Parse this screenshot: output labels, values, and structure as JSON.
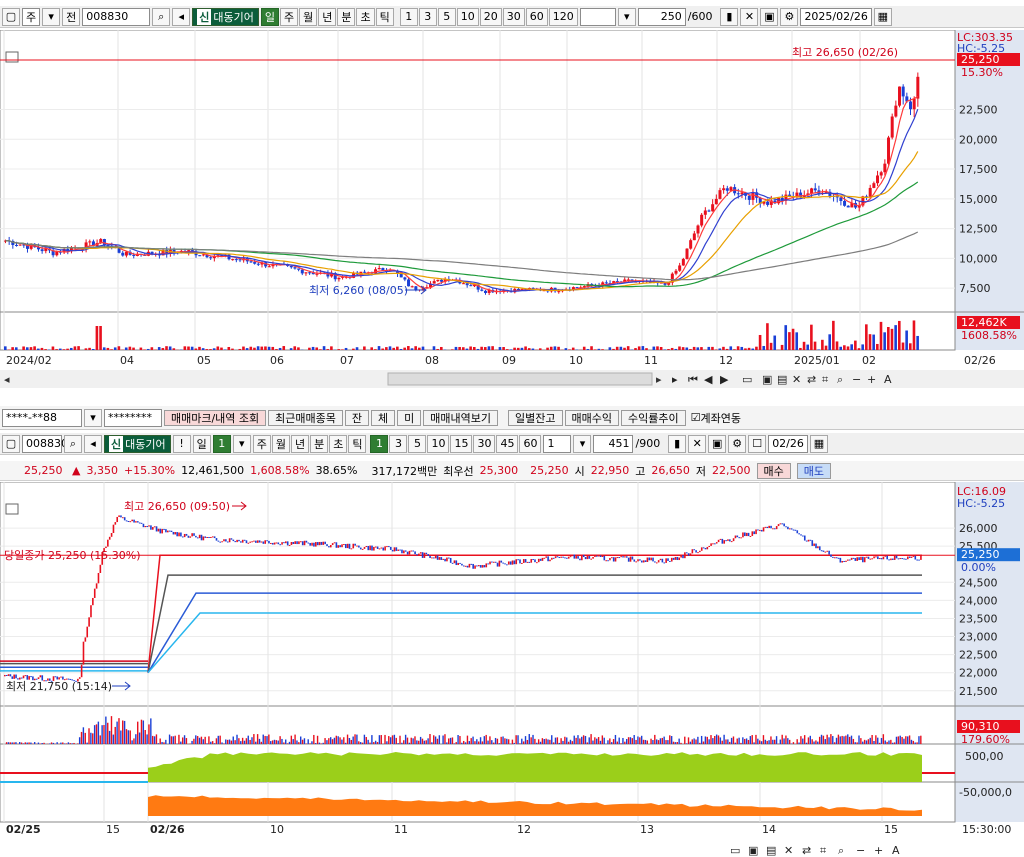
{
  "top_toolbar": {
    "period_label": "주",
    "prev_label": "전",
    "code": "008830",
    "credit_tag": "신",
    "stock_name": "대동기어",
    "period_buttons": [
      "일",
      "주",
      "월",
      "년",
      "분",
      "초",
      "틱"
    ],
    "active_period": "일",
    "interval_buttons": [
      "1",
      "3",
      "5",
      "10",
      "20",
      "30",
      "60",
      "120"
    ],
    "count": "250",
    "count_max": "/600",
    "date": "2025/02/26"
  },
  "daily_chart": {
    "lc_label": "LC:303.35",
    "hc_label": "HC:-5.25",
    "current_price": "25,250",
    "current_pct": "15.30%",
    "high_label": "최고 26,650 (02/26)",
    "low_label": "최저 6,260 (08/05)",
    "y_ticks": [
      "22,500",
      "20,000",
      "17,500",
      "15,000",
      "12,500",
      "10,000",
      "7,500"
    ],
    "x_ticks": [
      "2024/02",
      "04",
      "05",
      "06",
      "07",
      "08",
      "09",
      "10",
      "11",
      "12",
      "2025/01",
      "02",
      "02/26"
    ],
    "volume_label": "12,462K",
    "volume_pct": "1608.58%"
  },
  "order_bar": {
    "account": "****-**88",
    "password": "********",
    "buttons": [
      "매매마크/내역 조회",
      "최근매매종목",
      "잔",
      "체",
      "미",
      "매매내역보기",
      "일별잔고",
      "매매수익",
      "수익률추이"
    ],
    "checkbox_label": "계좌연동"
  },
  "intraday_toolbar": {
    "code": "008830",
    "credit_tag": "신",
    "stock_name": "대동기어",
    "alert": "!",
    "period_label": "일",
    "period_value": "1",
    "period_buttons": [
      "주",
      "월",
      "년",
      "분",
      "초",
      "틱"
    ],
    "intervals": [
      "1",
      "3",
      "5",
      "10",
      "15",
      "30",
      "45",
      "60"
    ],
    "interval_select": "1",
    "count": "451",
    "count_max": "/900",
    "date": "02/26"
  },
  "quote": {
    "price": "25,250",
    "change": "3,350",
    "change_pct": "+15.30%",
    "volume": "12,461,500",
    "volume_ratio": "1,608.58%",
    "turnover": "38.65%",
    "amount": "317,172백만",
    "best_ask_label": "최우선",
    "best_ask": "25,300",
    "best_bid": "25,250",
    "open_label": "시",
    "open": "22,950",
    "high_label": "고",
    "high": "26,650",
    "low_label": "저",
    "low": "22,500",
    "buy": "매수",
    "sell": "매도"
  },
  "intraday_chart": {
    "lc_label": "LC:16.09",
    "hc_label": "HC:-5.25",
    "high_label": "최고 26,650 (09:50)",
    "low_label": "최저 21,750 (15:14)",
    "close_label": "당일종가 25,250 (15.30%)",
    "current_price": "25,250",
    "current_pct": "0.00%",
    "y_ticks": [
      "26,000",
      "25,500",
      "24,500",
      "24,000",
      "23,500",
      "23,000",
      "22,500",
      "22,000",
      "21,500"
    ],
    "volume_label": "90,310",
    "volume_pct": "179.60%",
    "ind1_label": "500,00",
    "ind2_label": "-50,000,0",
    "x_ticks": [
      "02/25",
      "15",
      "02/26",
      "10",
      "11",
      "12",
      "13",
      "14",
      "15",
      "15:30:00"
    ]
  },
  "colors": {
    "up": "#e8101e",
    "down": "#1a3fd6",
    "green_area": "#9bcf1a",
    "orange_area": "#ff7a12",
    "axis_bg": "#dfe6f2",
    "price_tag": "#1d6fd6"
  }
}
